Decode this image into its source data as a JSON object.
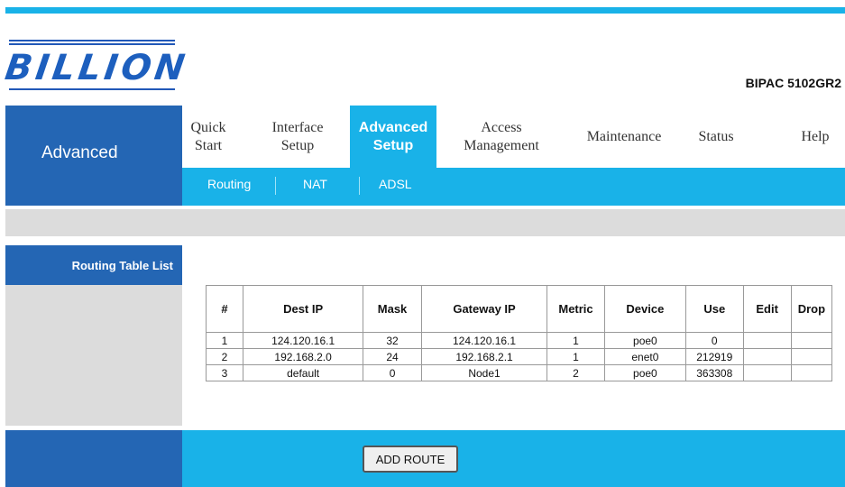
{
  "brand": {
    "logo_text": "BILLION",
    "model": "BIPAC 5102GR2"
  },
  "nav": {
    "section_title": "Advanced",
    "tabs": [
      {
        "label": "Quick\nStart"
      },
      {
        "label": "Interface\nSetup"
      },
      {
        "label": "Advanced\nSetup",
        "active": true
      },
      {
        "label": "Access\nManagement"
      },
      {
        "label": "Maintenance"
      },
      {
        "label": "Status"
      },
      {
        "label": "Help"
      }
    ],
    "subtabs": [
      {
        "label": "Routing"
      },
      {
        "label": "NAT"
      },
      {
        "label": "ADSL"
      }
    ]
  },
  "routing": {
    "section_label": "Routing Table List",
    "columns": [
      "#",
      "Dest IP",
      "Mask",
      "Gateway IP",
      "Metric",
      "Device",
      "Use",
      "Edit",
      "Drop"
    ],
    "rows": [
      [
        "1",
        "124.120.16.1",
        "32",
        "124.120.16.1",
        "1",
        "poe0",
        "0",
        "",
        ""
      ],
      [
        "2",
        "192.168.2.0",
        "24",
        "192.168.2.1",
        "1",
        "enet0",
        "212919",
        "",
        ""
      ],
      [
        "3",
        "default",
        "0",
        "Node1",
        "2",
        "poe0",
        "363308",
        "",
        ""
      ]
    ]
  },
  "footer": {
    "add_route_label": "ADD ROUTE"
  },
  "colors": {
    "header_blue": "#2466b4",
    "accent_cyan": "#19b2e8",
    "band_gray": "#dcdcdc"
  }
}
